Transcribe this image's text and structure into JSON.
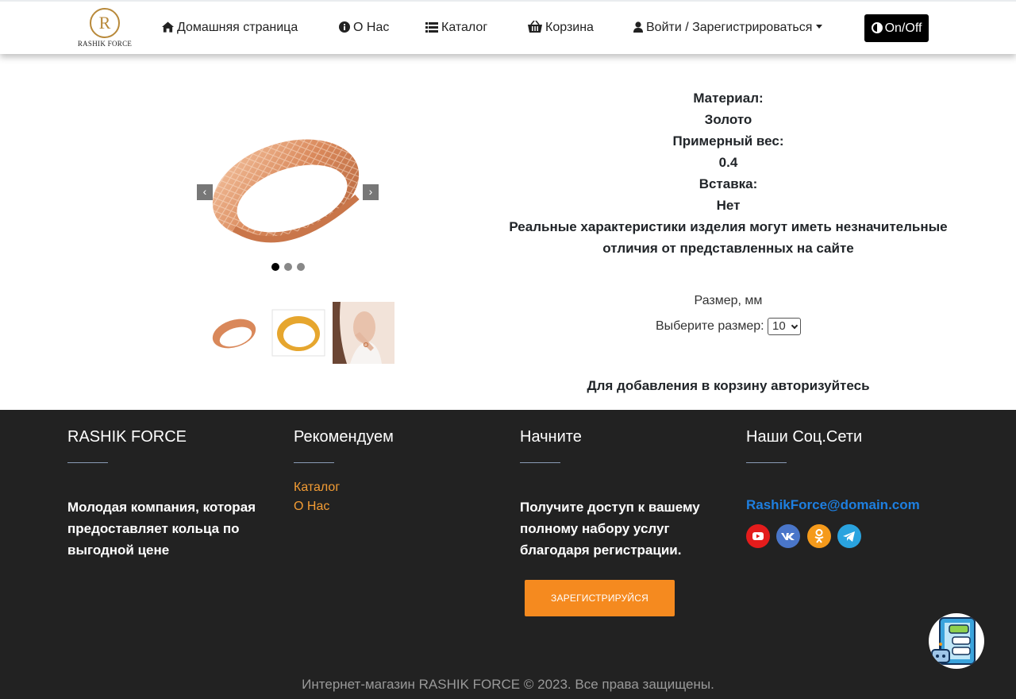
{
  "nav": {
    "logo_letter": "R",
    "logo_text": "RASHIK FORCE",
    "home": "Домашняя страница",
    "about": "О Нас",
    "catalog": "Каталог",
    "cart": "Корзина",
    "login": "Войти / Зарегистрироваться",
    "toggle": "On/Off",
    "icons": [
      "home-icon",
      "info-icon",
      "list-icon",
      "basket-icon",
      "user-icon",
      "contrast-icon"
    ]
  },
  "product": {
    "carousel": {
      "prev": "‹",
      "next": "›",
      "slides": 3,
      "active_slide": 1
    },
    "specs": {
      "material_label": "Материал:",
      "material_value": "Золото",
      "weight_label": "Примерный вес:",
      "weight_value": "0.4",
      "insert_label": "Вставка:",
      "insert_value": "Нет",
      "disclaimer": "Реальные характеристики изделия могут иметь незначительные отличия от представленных на сайте"
    },
    "size_title": "Размер, мм",
    "size_label": "Выберите размер:",
    "size_value": "10",
    "auth_note": "Для добавления в корзину авторизуйтесь"
  },
  "footer": {
    "col1": {
      "title": "RASHIK FORCE",
      "text": "Молодая компания, которая предоставляет кольца по выгодной цене"
    },
    "col2": {
      "title": "Рекомендуем",
      "links": [
        "Каталог",
        "О Нас"
      ]
    },
    "col3": {
      "title": "Начните",
      "text": "Получите доступ к вашему полному набору услуг благодаря регистрации.",
      "button": "ЗАРЕГИСТРИРУЙСЯ"
    },
    "col4": {
      "title": "Наши Соц.Сети",
      "email": "RashikForce@domain.com",
      "socials": [
        "youtube-icon",
        "vk-icon",
        "odnoklassniki-icon",
        "telegram-icon"
      ]
    },
    "copyright": "Интернет-магазин RASHIK FORCE © 2023. Все права защищены."
  },
  "colors": {
    "accent": "#f58a1f",
    "footer_bg": "#222222",
    "link_blue": "#1e7fe0",
    "gold": "#b8893a"
  }
}
